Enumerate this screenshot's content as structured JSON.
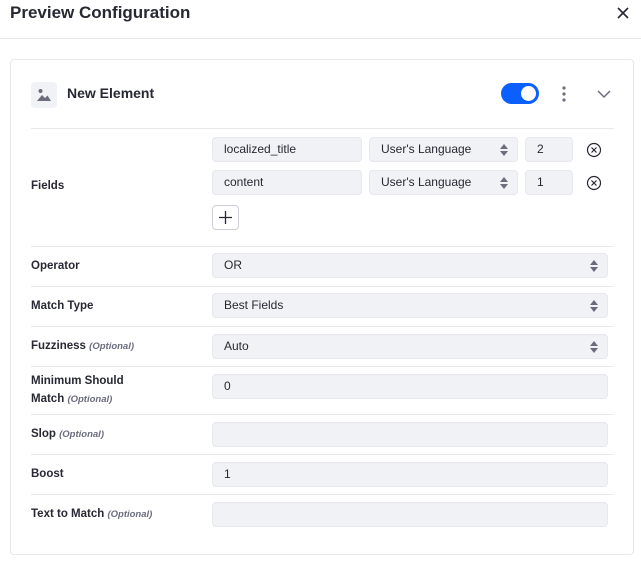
{
  "modal": {
    "title": "Preview Configuration"
  },
  "element": {
    "title": "New Element",
    "enabled": true
  },
  "fields": {
    "label": "Fields",
    "rows": [
      {
        "field": "localized_title",
        "locale": "User's Language",
        "boost": "2"
      },
      {
        "field": "content",
        "locale": "User's Language",
        "boost": "1"
      }
    ]
  },
  "operator": {
    "label": "Operator",
    "value": "OR"
  },
  "match_type": {
    "label": "Match Type",
    "value": "Best Fields"
  },
  "fuzziness": {
    "label": "Fuzziness",
    "optional": "(Optional)",
    "value": "Auto"
  },
  "minimum_should_match": {
    "label_line1": "Minimum Should",
    "label_line2": "Match",
    "optional": "(Optional)",
    "value": "0"
  },
  "slop": {
    "label": "Slop",
    "optional": "(Optional)",
    "value": ""
  },
  "boost": {
    "label": "Boost",
    "value": "1"
  },
  "text_to_match": {
    "label": "Text to Match",
    "optional": "(Optional)",
    "value": ""
  },
  "colors": {
    "accent": "#0b5fff",
    "field_bg": "#f1f2f5",
    "border": "#e7e7ed",
    "text": "#272833",
    "muted": "#6b6c7e"
  }
}
